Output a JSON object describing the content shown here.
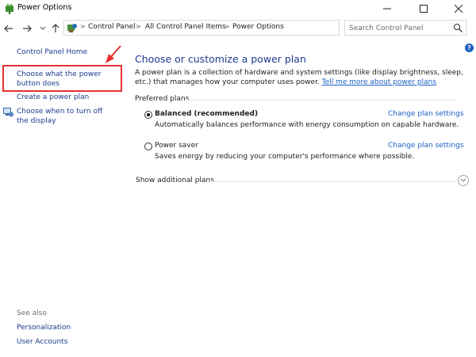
{
  "window": {
    "title": "Power Options",
    "icon": "power-options-icon",
    "controls": [
      "minimize-icon",
      "maximize-icon",
      "close-icon"
    ]
  },
  "nav": {
    "breadcrumbs": [
      "Control Panel",
      "All Control Panel Items",
      "Power Options"
    ],
    "search_placeholder": "Search Control Panel"
  },
  "sidebar": {
    "home": "Control Panel Home",
    "tasks": [
      "Choose what the power button does",
      "Create a power plan",
      "Choose when to turn off the display"
    ],
    "see_also_title": "See also",
    "see_also": [
      "Personalization",
      "User Accounts"
    ]
  },
  "main": {
    "title": "Choose or customize a power plan",
    "intro": "A power plan is a collection of hardware and system settings (like display brightness, sleep, etc.) that manages how your computer uses power. ",
    "intro_link": "Tell me more about power plans",
    "preferred_plans_label": "Preferred plans",
    "plans": [
      {
        "name": "Balanced (recommended)",
        "selected": true,
        "description": "Automatically balances performance with energy consumption on capable hardware.",
        "change_link": "Change plan settings"
      },
      {
        "name": "Power saver",
        "selected": false,
        "description": "Saves energy by reducing your computer's performance where possible.",
        "change_link": "Change plan settings"
      }
    ],
    "show_additional": "Show additional plans"
  },
  "colors": {
    "link": "#1a5fc7",
    "heading": "#1e3b8e",
    "highlight": "#e53232"
  }
}
